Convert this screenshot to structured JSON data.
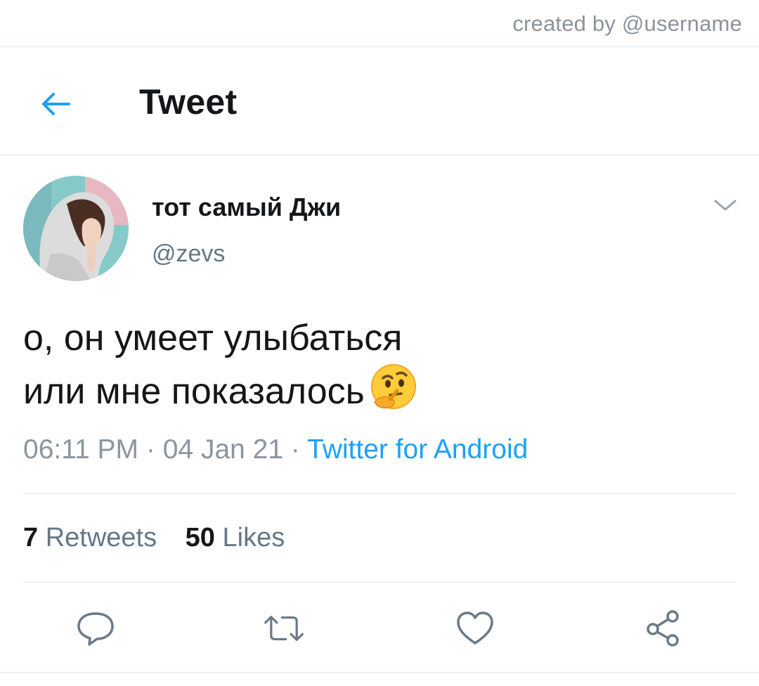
{
  "watermark": "created by @username",
  "header": {
    "back_icon": "arrow-left-icon",
    "title": "Tweet"
  },
  "tweet": {
    "author": {
      "display_name": "тот самый Джи",
      "handle": "@zevs"
    },
    "menu_icon": "chevron-down-icon",
    "text_lines": [
      "о, он умеет улыбаться",
      "или мне показалось"
    ],
    "emoji": "thinking-face-icon",
    "time": "06:11 PM",
    "date": "04 Jan 21",
    "separator": "·",
    "source": "Twitter for Android",
    "retweets_count": "7",
    "retweets_label": "Retweets",
    "likes_count": "50",
    "likes_label": "Likes"
  },
  "actions": {
    "reply_icon": "reply-icon",
    "retweet_icon": "retweet-icon",
    "like_icon": "heart-icon",
    "share_icon": "share-icon"
  },
  "colors": {
    "accent": "#1da1f2",
    "text_primary": "#14171a",
    "text_secondary": "#657786",
    "divider": "#e1e5e8"
  }
}
